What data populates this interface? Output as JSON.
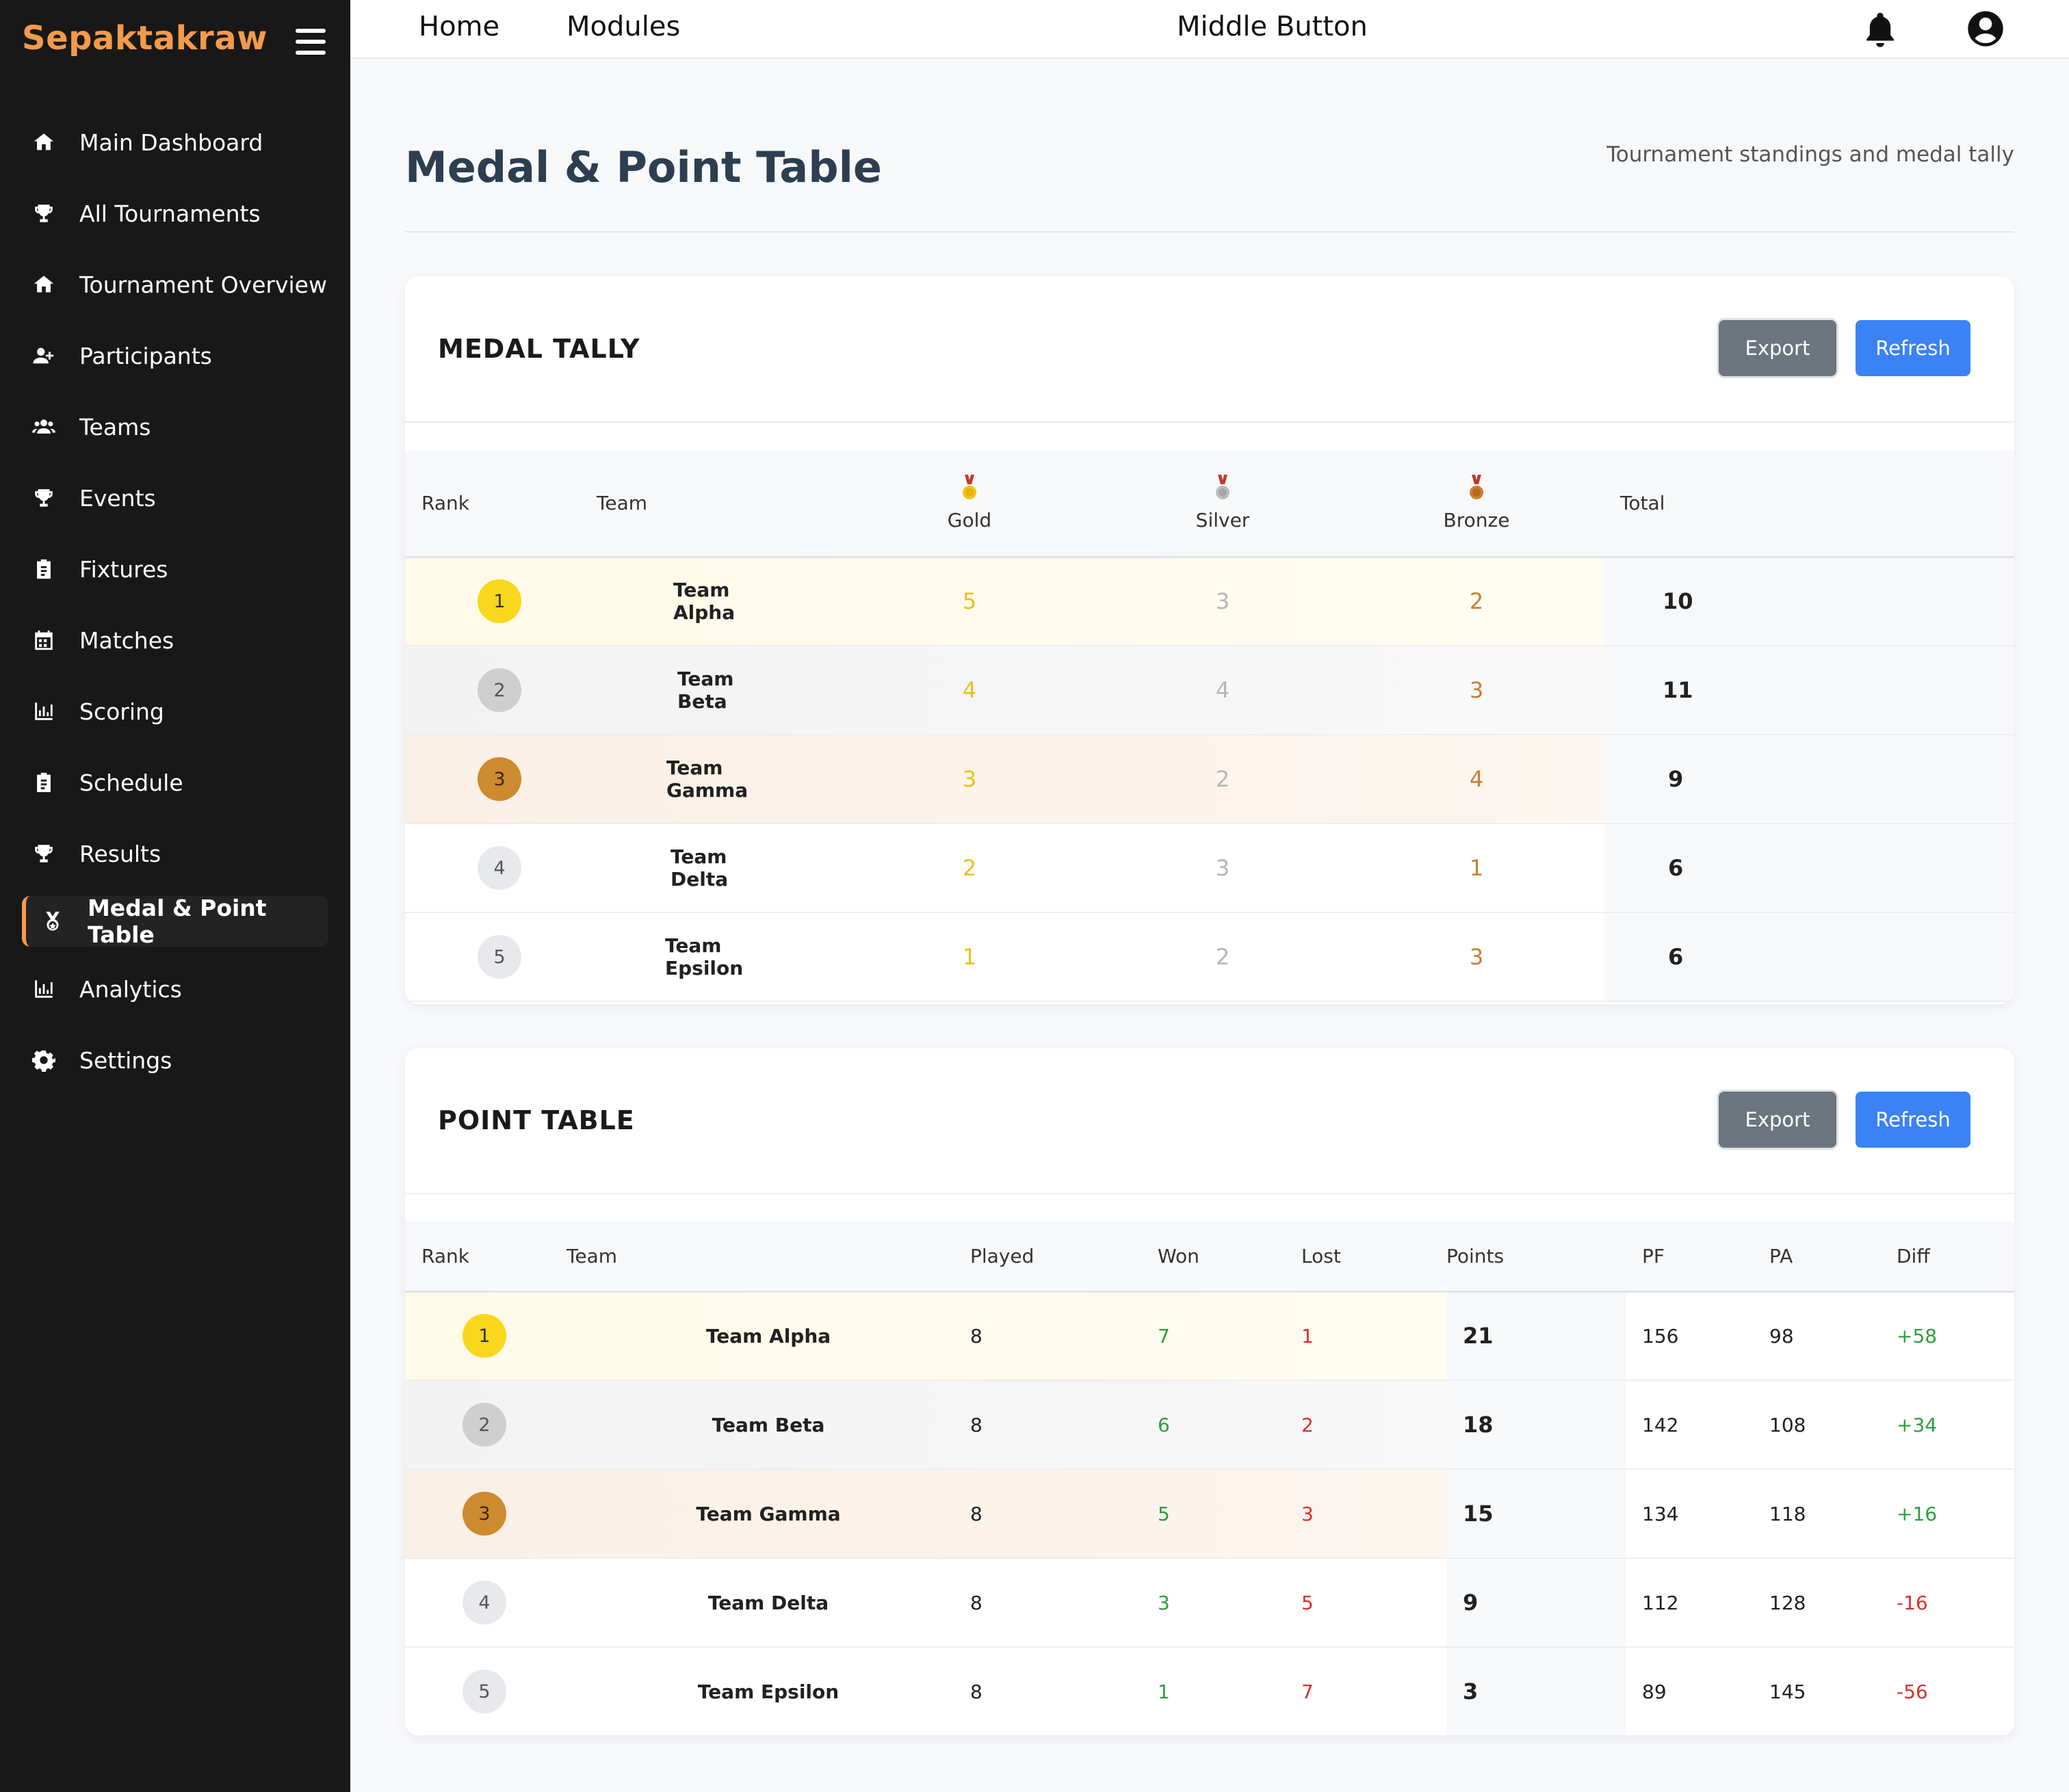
{
  "brand": "Sepaktakraw",
  "topbar": {
    "home": "Home",
    "modules": "Modules",
    "middle": "Middle Button"
  },
  "sidebar": {
    "items": [
      {
        "label": "Main Dashboard",
        "icon": "home-icon"
      },
      {
        "label": "All Tournaments",
        "icon": "trophy-icon"
      },
      {
        "label": "Tournament Overview",
        "icon": "home-icon"
      },
      {
        "label": "Participants",
        "icon": "user-plus-icon"
      },
      {
        "label": "Teams",
        "icon": "users-icon"
      },
      {
        "label": "Events",
        "icon": "trophy-icon"
      },
      {
        "label": "Fixtures",
        "icon": "clipboard-icon"
      },
      {
        "label": "Matches",
        "icon": "calendar-icon"
      },
      {
        "label": "Scoring",
        "icon": "bar-chart-icon"
      },
      {
        "label": "Schedule",
        "icon": "clipboard-icon"
      },
      {
        "label": "Results",
        "icon": "trophy-icon"
      },
      {
        "label": "Medal & Point Table",
        "icon": "medal-icon",
        "active": true
      },
      {
        "label": "Analytics",
        "icon": "bar-chart-icon"
      },
      {
        "label": "Settings",
        "icon": "gear-icon"
      }
    ]
  },
  "page": {
    "title": "Medal & Point Table",
    "subtitle": "Tournament standings and medal tally"
  },
  "medal_tally": {
    "title": "MEDAL TALLY",
    "export_label": "Export",
    "refresh_label": "Refresh",
    "columns": {
      "rank": "Rank",
      "team": "Team",
      "gold": "Gold",
      "silver": "Silver",
      "bronze": "Bronze",
      "total": "Total"
    },
    "rows": [
      {
        "rank": "1",
        "team": "Team Alpha",
        "gold": "5",
        "silver": "3",
        "bronze": "2",
        "total": "10"
      },
      {
        "rank": "2",
        "team": "Team Beta",
        "gold": "4",
        "silver": "4",
        "bronze": "3",
        "total": "11"
      },
      {
        "rank": "3",
        "team": "Team Gamma",
        "gold": "3",
        "silver": "2",
        "bronze": "4",
        "total": "9"
      },
      {
        "rank": "4",
        "team": "Team Delta",
        "gold": "2",
        "silver": "3",
        "bronze": "1",
        "total": "6"
      },
      {
        "rank": "5",
        "team": "Team Epsilon",
        "gold": "1",
        "silver": "2",
        "bronze": "3",
        "total": "6"
      }
    ]
  },
  "point_table": {
    "title": "POINT TABLE",
    "export_label": "Export",
    "refresh_label": "Refresh",
    "columns": {
      "rank": "Rank",
      "team": "Team",
      "played": "Played",
      "won": "Won",
      "lost": "Lost",
      "points": "Points",
      "pf": "PF",
      "pa": "PA",
      "diff": "Diff"
    },
    "rows": [
      {
        "rank": "1",
        "team": "Team Alpha",
        "played": "8",
        "won": "7",
        "lost": "1",
        "points": "21",
        "pf": "156",
        "pa": "98",
        "diff": "+58"
      },
      {
        "rank": "2",
        "team": "Team Beta",
        "played": "8",
        "won": "6",
        "lost": "2",
        "points": "18",
        "pf": "142",
        "pa": "108",
        "diff": "+34"
      },
      {
        "rank": "3",
        "team": "Team Gamma",
        "played": "8",
        "won": "5",
        "lost": "3",
        "points": "15",
        "pf": "134",
        "pa": "118",
        "diff": "+16"
      },
      {
        "rank": "4",
        "team": "Team Delta",
        "played": "8",
        "won": "3",
        "lost": "5",
        "points": "9",
        "pf": "112",
        "pa": "128",
        "diff": "-16"
      },
      {
        "rank": "5",
        "team": "Team Epsilon",
        "played": "8",
        "won": "1",
        "lost": "7",
        "points": "3",
        "pf": "89",
        "pa": "145",
        "diff": "-56"
      }
    ]
  },
  "colors": {
    "brand": "#f39a4b",
    "sidebar_bg": "#181818",
    "primary": "#3b82f6",
    "secondary": "#6c757d",
    "positive": "#2e9e3e",
    "negative": "#d9302c"
  }
}
